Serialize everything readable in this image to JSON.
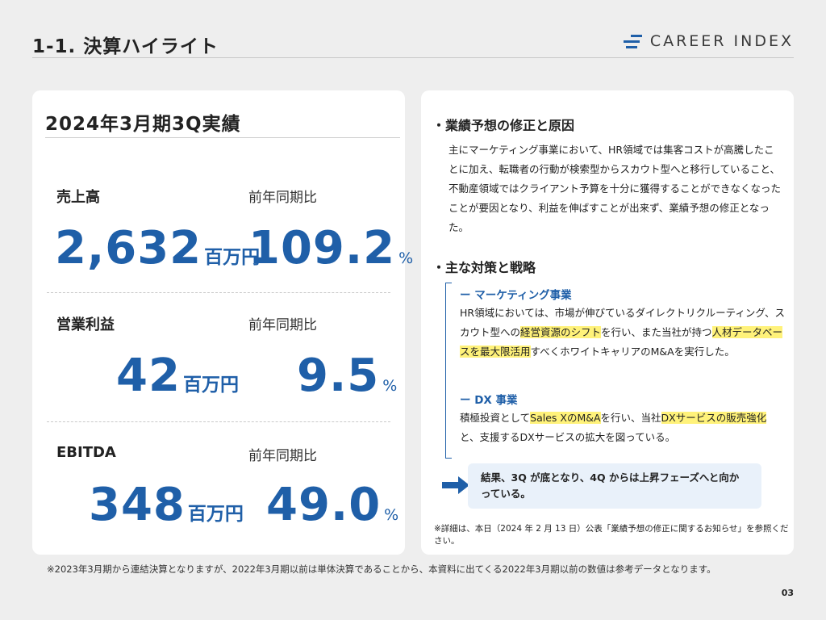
{
  "header": {
    "title": "1-1. 決算ハイライト",
    "logo_text": "CAREER INDEX",
    "brand_color": "#1f5fa8"
  },
  "summary": {
    "period_title": "2024年3月期3Q実績",
    "metrics": [
      {
        "label": "売上高",
        "value": "2,632",
        "unit": "百万円",
        "yoy_label": "前年同期比",
        "yoy_value": "109.2",
        "yoy_unit": "%"
      },
      {
        "label": "営業利益",
        "value": "42",
        "unit": "百万円",
        "yoy_label": "前年同期比",
        "yoy_value": "9.5",
        "yoy_unit": "%"
      },
      {
        "label": "EBITDA",
        "value": "348",
        "unit": "百万円",
        "yoy_label": "前年同期比",
        "yoy_value": "49.0",
        "yoy_unit": "%"
      }
    ]
  },
  "detail": {
    "revision_head": "・業績予想の修正と原因",
    "revision_body": "主にマーケティング事業において、HR領域では集客コストが高騰したことに加え、転職者の行動が検索型からスカウト型へと移行していること、不動産領域ではクライアント予算を十分に獲得することができなくなったことが要因となり、利益を伸ばすことが出来ず、業績予想の修正となった。",
    "measures_head": "・主な対策と戦略",
    "marketing": {
      "head": "ー マーケティング事業",
      "t1": "HR領域においては、市場が伸びているダイレクトリクルーティング、スカウト型への",
      "h1": "経営資源のシフト",
      "t2": "を行い、また当社が持つ",
      "h2": "人材データベースを最大限活用",
      "t3": "すべくホワイトキャリアのM&Aを実行した。"
    },
    "dx": {
      "head": "ー DX 事業",
      "t1": "積極投資として",
      "h1": "Sales XのM&A",
      "t2": "を行い、当社",
      "h2": "DXサービスの販売強化",
      "t3": "と、支援するDXサービスの拡大を図っている。"
    },
    "callout": "結果、3Q が底となり、4Q からは上昇フェーズへと向かっている。",
    "note": "※詳細は、本日（2024 年 2 月 13 日）公表「業績予想の修正に関するお知らせ」を参照ください。"
  },
  "footnote": "※2023年3月期から連結決算となりますが、2022年3月期以前は単体決算であることから、本資料に出てくる2022年3月期以前の数値は参考データとなります。",
  "page_number": "03"
}
